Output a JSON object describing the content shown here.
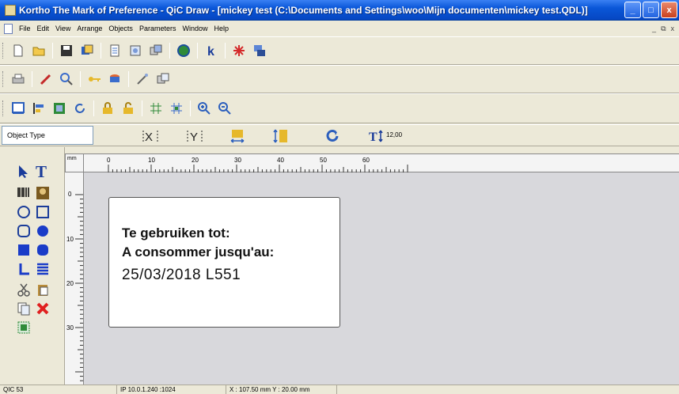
{
  "window": {
    "title": "Kortho The Mark of Preference - QiC Draw - [mickey test  (C:\\Documents and Settings\\woo\\Mijn documenten\\mickey test.QDL)]",
    "controls": {
      "minimize": "_",
      "maximize": "□",
      "close": "x"
    }
  },
  "menu": {
    "items": [
      "File",
      "Edit",
      "View",
      "Arrange",
      "Objects",
      "Parameters",
      "Window",
      "Help"
    ],
    "mdi_controls": {
      "minimize": "_",
      "restore": "⧉",
      "close": "x"
    }
  },
  "toolbar1": [
    "new-file-icon",
    "open-folder-icon",
    "save-icon",
    "save-all-icon",
    "document-icon",
    "print-preview-icon",
    "copy-format-icon",
    "globe-icon",
    "kortho-k-icon",
    "asterisk-icon",
    "stack-icon"
  ],
  "toolbar2": [
    "printer-icon",
    "pen-icon",
    "magnifier-icon",
    "key-icon",
    "database-icon",
    "tools-icon",
    "layers-icon"
  ],
  "toolbar3": [
    "window-icon",
    "align-icon",
    "frame-icon",
    "rotate-icon",
    "lock-icon",
    "unlock-icon",
    "grid-icon",
    "grid-snap-icon",
    "zoom-in-icon",
    "zoom-out-icon"
  ],
  "object_bar": {
    "object_type_label": "Object Type",
    "font_size": "12,00"
  },
  "rulers": {
    "unit": "mm",
    "h_ticks": [
      "0",
      "10",
      "20",
      "30",
      "40",
      "50",
      "60"
    ],
    "v_ticks": [
      "0",
      "10",
      "20",
      "30"
    ]
  },
  "label": {
    "line1": "Te gebruiken tot:",
    "line2": "A consommer jusqu'au:",
    "line3": "25/03/2018  L551"
  },
  "status": {
    "printer": "QIC 53",
    "ip": "IP 10.0.1.240 :1024",
    "coords": "X : 107.50 mm Y : 20.00 mm"
  },
  "colors": {
    "title_bar": "#0a57d8",
    "canvas_bg": "#d8d8dc",
    "chrome": "#ece9d8"
  }
}
